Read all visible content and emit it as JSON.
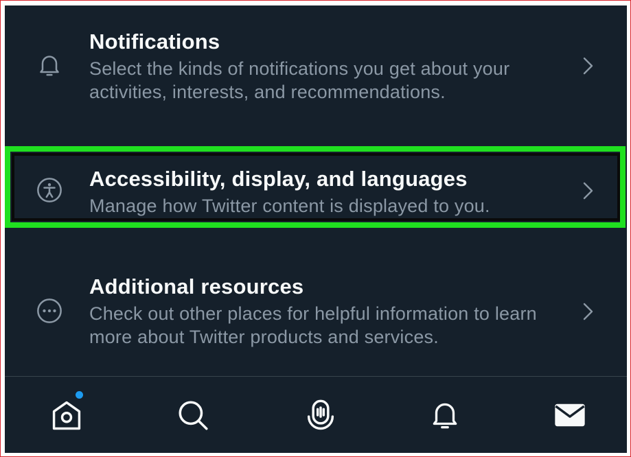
{
  "settings": {
    "items": [
      {
        "title": "Notifications",
        "description": "Select the kinds of notifications you get about your activities, interests, and recommendations.",
        "icon": "bell-icon"
      },
      {
        "title": "Accessibility, display, and languages",
        "description": "Manage how Twitter content is displayed to you.",
        "icon": "accessibility-icon",
        "highlighted": true
      },
      {
        "title": "Additional resources",
        "description": "Check out other places for helpful information to learn more about Twitter products and services.",
        "icon": "more-circle-icon"
      }
    ]
  },
  "tabbar": {
    "tabs": [
      {
        "name": "home",
        "icon": "home-icon",
        "has_badge": true
      },
      {
        "name": "search",
        "icon": "search-icon"
      },
      {
        "name": "spaces",
        "icon": "spaces-mic-icon"
      },
      {
        "name": "notifications",
        "icon": "bell-icon"
      },
      {
        "name": "messages",
        "icon": "envelope-icon"
      }
    ]
  },
  "colors": {
    "background": "#15202b",
    "primary_text": "#f7f9f9",
    "secondary_text": "#8b98a5",
    "highlight": "#20e020",
    "badge": "#1d9bf0"
  }
}
